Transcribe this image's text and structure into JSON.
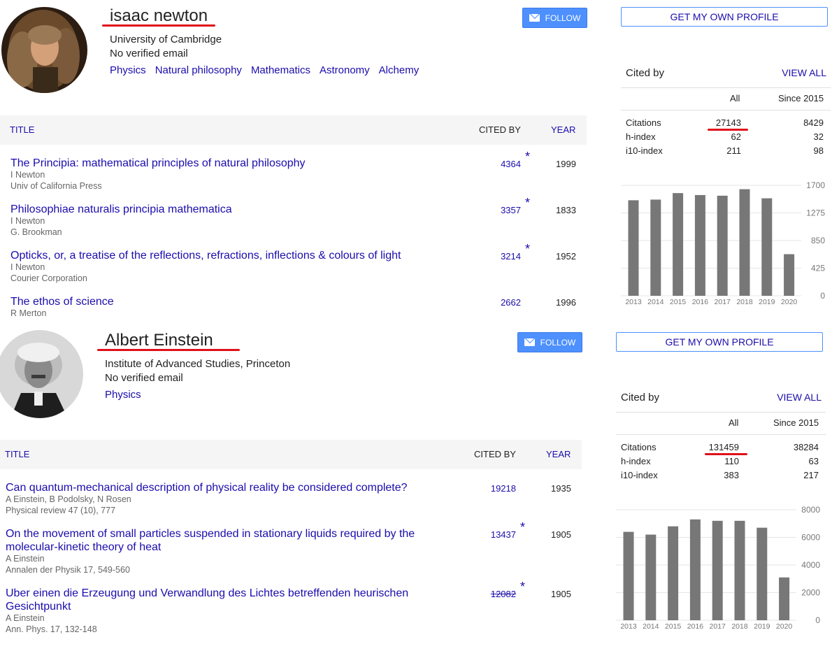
{
  "profiles": [
    {
      "name": "isaac newton",
      "affiliation": "University of Cambridge",
      "email": "No verified email",
      "interests": [
        "Physics",
        "Natural philosophy",
        "Mathematics",
        "Astronomy",
        "Alchemy"
      ],
      "follow_label": "FOLLOW",
      "own_profile_label": "GET MY OWN PROFILE",
      "table_headers": {
        "title": "TITLE",
        "cited_by": "CITED BY",
        "year": "YEAR"
      },
      "articles": [
        {
          "title": "The Principia: mathematical principles of natural philosophy",
          "authors": "I Newton",
          "venue": "Univ of California Press",
          "cited_by": "4364",
          "star": "*",
          "year": "1999"
        },
        {
          "title": "Philosophiae naturalis principia mathematica",
          "authors": "I Newton",
          "venue": "G. Brookman",
          "cited_by": "3357",
          "star": "*",
          "year": "1833"
        },
        {
          "title": "Opticks, or, a treatise of the reflections, refractions, inflections & colours of light",
          "authors": "I Newton",
          "venue": "Courier Corporation",
          "cited_by": "3214",
          "star": "*",
          "year": "1952"
        },
        {
          "title": "The ethos of science",
          "authors": "R Merton",
          "venue": "",
          "cited_by": "2662",
          "star": "",
          "year": "1996"
        }
      ],
      "cited_by": {
        "title": "Cited by",
        "view_all": "VIEW ALL",
        "col_all": "All",
        "col_since": "Since 2015",
        "rows": [
          {
            "label": "Citations",
            "all": "27143",
            "since": "8429"
          },
          {
            "label": "h-index",
            "all": "62",
            "since": "32"
          },
          {
            "label": "i10-index",
            "all": "211",
            "since": "98"
          }
        ]
      },
      "chart_data": {
        "type": "bar",
        "categories": [
          "2013",
          "2014",
          "2015",
          "2016",
          "2017",
          "2018",
          "2019",
          "2020"
        ],
        "values": [
          1470,
          1480,
          1580,
          1550,
          1540,
          1640,
          1500,
          640
        ],
        "ylim": [
          0,
          1700
        ],
        "yticks": [
          "1700",
          "1275",
          "850",
          "425",
          "0"
        ],
        "bar_color": "#777777"
      }
    },
    {
      "name": "Albert Einstein",
      "affiliation": "Institute of Advanced Studies, Princeton",
      "email": "No verified email",
      "interests": [
        "Physics"
      ],
      "follow_label": "FOLLOW",
      "own_profile_label": "GET MY OWN PROFILE",
      "table_headers": {
        "title": "TITLE",
        "cited_by": "CITED BY",
        "year": "YEAR"
      },
      "articles": [
        {
          "title": "Can quantum-mechanical description of physical reality be considered complete?",
          "authors": "A Einstein, B Podolsky, N Rosen",
          "venue": "Physical review 47 (10), 777",
          "cited_by": "19218",
          "star": "",
          "year": "1935"
        },
        {
          "title": "On the movement of small particles suspended in stationary liquids required by the molecular-kinetic theory of heat",
          "authors": "A Einstein",
          "venue": "Annalen der Physik 17, 549-560",
          "cited_by": "13437",
          "star": "*",
          "year": "1905"
        },
        {
          "title": "Uber einen die Erzeugung und Verwandlung des Lichtes betreffenden heurischen Gesichtpunkt",
          "authors": "A Einstein",
          "venue": "Ann. Phys. 17, 132-148",
          "cited_by": "12082",
          "star": "*",
          "year": "1905"
        }
      ],
      "cited_by": {
        "title": "Cited by",
        "view_all": "VIEW ALL",
        "col_all": "All",
        "col_since": "Since 2015",
        "rows": [
          {
            "label": "Citations",
            "all": "131459",
            "since": "38284"
          },
          {
            "label": "h-index",
            "all": "110",
            "since": "63"
          },
          {
            "label": "i10-index",
            "all": "383",
            "since": "217"
          }
        ]
      },
      "chart_data": {
        "type": "bar",
        "categories": [
          "2013",
          "2014",
          "2015",
          "2016",
          "2017",
          "2018",
          "2019",
          "2020"
        ],
        "values": [
          6400,
          6200,
          6800,
          7300,
          7200,
          7200,
          6700,
          3100
        ],
        "ylim": [
          0,
          8000
        ],
        "yticks": [
          "8000",
          "6000",
          "4000",
          "2000",
          "0"
        ],
        "bar_color": "#777777"
      }
    }
  ]
}
